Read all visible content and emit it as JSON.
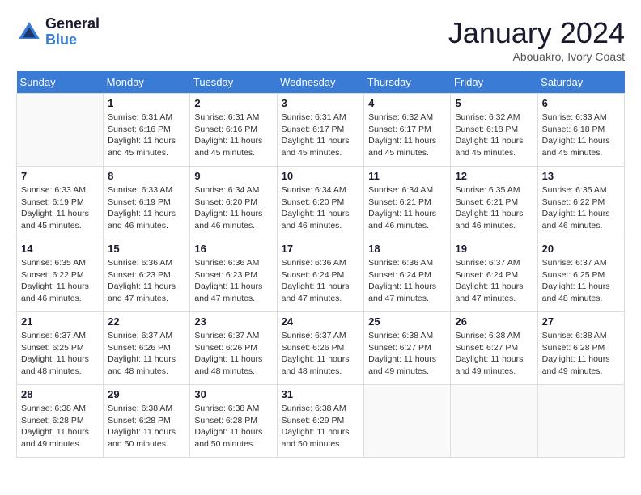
{
  "header": {
    "logo_line1": "General",
    "logo_line2": "Blue",
    "month": "January 2024",
    "location": "Abouakro, Ivory Coast"
  },
  "days_of_week": [
    "Sunday",
    "Monday",
    "Tuesday",
    "Wednesday",
    "Thursday",
    "Friday",
    "Saturday"
  ],
  "weeks": [
    [
      {
        "day": "",
        "sunrise": "",
        "sunset": "",
        "daylight": ""
      },
      {
        "day": "1",
        "sunrise": "Sunrise: 6:31 AM",
        "sunset": "Sunset: 6:16 PM",
        "daylight": "Daylight: 11 hours and 45 minutes."
      },
      {
        "day": "2",
        "sunrise": "Sunrise: 6:31 AM",
        "sunset": "Sunset: 6:16 PM",
        "daylight": "Daylight: 11 hours and 45 minutes."
      },
      {
        "day": "3",
        "sunrise": "Sunrise: 6:31 AM",
        "sunset": "Sunset: 6:17 PM",
        "daylight": "Daylight: 11 hours and 45 minutes."
      },
      {
        "day": "4",
        "sunrise": "Sunrise: 6:32 AM",
        "sunset": "Sunset: 6:17 PM",
        "daylight": "Daylight: 11 hours and 45 minutes."
      },
      {
        "day": "5",
        "sunrise": "Sunrise: 6:32 AM",
        "sunset": "Sunset: 6:18 PM",
        "daylight": "Daylight: 11 hours and 45 minutes."
      },
      {
        "day": "6",
        "sunrise": "Sunrise: 6:33 AM",
        "sunset": "Sunset: 6:18 PM",
        "daylight": "Daylight: 11 hours and 45 minutes."
      }
    ],
    [
      {
        "day": "7",
        "sunrise": "Sunrise: 6:33 AM",
        "sunset": "Sunset: 6:19 PM",
        "daylight": "Daylight: 11 hours and 45 minutes."
      },
      {
        "day": "8",
        "sunrise": "Sunrise: 6:33 AM",
        "sunset": "Sunset: 6:19 PM",
        "daylight": "Daylight: 11 hours and 46 minutes."
      },
      {
        "day": "9",
        "sunrise": "Sunrise: 6:34 AM",
        "sunset": "Sunset: 6:20 PM",
        "daylight": "Daylight: 11 hours and 46 minutes."
      },
      {
        "day": "10",
        "sunrise": "Sunrise: 6:34 AM",
        "sunset": "Sunset: 6:20 PM",
        "daylight": "Daylight: 11 hours and 46 minutes."
      },
      {
        "day": "11",
        "sunrise": "Sunrise: 6:34 AM",
        "sunset": "Sunset: 6:21 PM",
        "daylight": "Daylight: 11 hours and 46 minutes."
      },
      {
        "day": "12",
        "sunrise": "Sunrise: 6:35 AM",
        "sunset": "Sunset: 6:21 PM",
        "daylight": "Daylight: 11 hours and 46 minutes."
      },
      {
        "day": "13",
        "sunrise": "Sunrise: 6:35 AM",
        "sunset": "Sunset: 6:22 PM",
        "daylight": "Daylight: 11 hours and 46 minutes."
      }
    ],
    [
      {
        "day": "14",
        "sunrise": "Sunrise: 6:35 AM",
        "sunset": "Sunset: 6:22 PM",
        "daylight": "Daylight: 11 hours and 46 minutes."
      },
      {
        "day": "15",
        "sunrise": "Sunrise: 6:36 AM",
        "sunset": "Sunset: 6:23 PM",
        "daylight": "Daylight: 11 hours and 47 minutes."
      },
      {
        "day": "16",
        "sunrise": "Sunrise: 6:36 AM",
        "sunset": "Sunset: 6:23 PM",
        "daylight": "Daylight: 11 hours and 47 minutes."
      },
      {
        "day": "17",
        "sunrise": "Sunrise: 6:36 AM",
        "sunset": "Sunset: 6:24 PM",
        "daylight": "Daylight: 11 hours and 47 minutes."
      },
      {
        "day": "18",
        "sunrise": "Sunrise: 6:36 AM",
        "sunset": "Sunset: 6:24 PM",
        "daylight": "Daylight: 11 hours and 47 minutes."
      },
      {
        "day": "19",
        "sunrise": "Sunrise: 6:37 AM",
        "sunset": "Sunset: 6:24 PM",
        "daylight": "Daylight: 11 hours and 47 minutes."
      },
      {
        "day": "20",
        "sunrise": "Sunrise: 6:37 AM",
        "sunset": "Sunset: 6:25 PM",
        "daylight": "Daylight: 11 hours and 48 minutes."
      }
    ],
    [
      {
        "day": "21",
        "sunrise": "Sunrise: 6:37 AM",
        "sunset": "Sunset: 6:25 PM",
        "daylight": "Daylight: 11 hours and 48 minutes."
      },
      {
        "day": "22",
        "sunrise": "Sunrise: 6:37 AM",
        "sunset": "Sunset: 6:26 PM",
        "daylight": "Daylight: 11 hours and 48 minutes."
      },
      {
        "day": "23",
        "sunrise": "Sunrise: 6:37 AM",
        "sunset": "Sunset: 6:26 PM",
        "daylight": "Daylight: 11 hours and 48 minutes."
      },
      {
        "day": "24",
        "sunrise": "Sunrise: 6:37 AM",
        "sunset": "Sunset: 6:26 PM",
        "daylight": "Daylight: 11 hours and 48 minutes."
      },
      {
        "day": "25",
        "sunrise": "Sunrise: 6:38 AM",
        "sunset": "Sunset: 6:27 PM",
        "daylight": "Daylight: 11 hours and 49 minutes."
      },
      {
        "day": "26",
        "sunrise": "Sunrise: 6:38 AM",
        "sunset": "Sunset: 6:27 PM",
        "daylight": "Daylight: 11 hours and 49 minutes."
      },
      {
        "day": "27",
        "sunrise": "Sunrise: 6:38 AM",
        "sunset": "Sunset: 6:28 PM",
        "daylight": "Daylight: 11 hours and 49 minutes."
      }
    ],
    [
      {
        "day": "28",
        "sunrise": "Sunrise: 6:38 AM",
        "sunset": "Sunset: 6:28 PM",
        "daylight": "Daylight: 11 hours and 49 minutes."
      },
      {
        "day": "29",
        "sunrise": "Sunrise: 6:38 AM",
        "sunset": "Sunset: 6:28 PM",
        "daylight": "Daylight: 11 hours and 50 minutes."
      },
      {
        "day": "30",
        "sunrise": "Sunrise: 6:38 AM",
        "sunset": "Sunset: 6:28 PM",
        "daylight": "Daylight: 11 hours and 50 minutes."
      },
      {
        "day": "31",
        "sunrise": "Sunrise: 6:38 AM",
        "sunset": "Sunset: 6:29 PM",
        "daylight": "Daylight: 11 hours and 50 minutes."
      },
      {
        "day": "",
        "sunrise": "",
        "sunset": "",
        "daylight": ""
      },
      {
        "day": "",
        "sunrise": "",
        "sunset": "",
        "daylight": ""
      },
      {
        "day": "",
        "sunrise": "",
        "sunset": "",
        "daylight": ""
      }
    ]
  ]
}
